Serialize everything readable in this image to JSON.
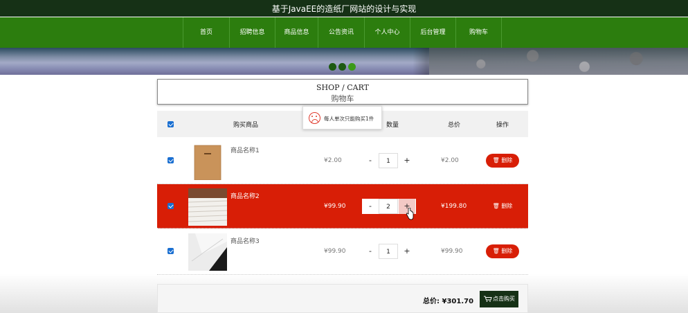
{
  "site": {
    "title": "基于JavaEE的造纸厂网站的设计与实现"
  },
  "nav": {
    "items": [
      {
        "label": "首页",
        "id": "home"
      },
      {
        "label": "招聘信息",
        "id": "jobs"
      },
      {
        "label": "商品信息",
        "id": "products"
      },
      {
        "label": "公告资讯",
        "id": "news"
      },
      {
        "label": "个人中心",
        "id": "profile"
      },
      {
        "label": "后台管理",
        "id": "admin"
      },
      {
        "label": "购物车",
        "id": "cart"
      }
    ]
  },
  "carousel": {
    "dots": 3,
    "active_index": 2
  },
  "page_header": {
    "title_en": "SHOP / CART",
    "title_zh": "购物车"
  },
  "tooltip": {
    "message": "每人单次只能购买1件",
    "icon": "sad-face-icon"
  },
  "table": {
    "headers": {
      "product": "购买商品",
      "qty": "数量",
      "total": "总价",
      "action": "操作"
    },
    "rows": [
      {
        "name": "商品名称1",
        "price": "¥2.00",
        "qty": "1",
        "total": "¥2.00",
        "checked": true,
        "delete_label": "删除",
        "minus": "-",
        "plus": "+"
      },
      {
        "name": "商品名称2",
        "price": "¥99.90",
        "qty": "2",
        "total": "¥199.80",
        "checked": true,
        "delete_label": "删除",
        "minus": "-",
        "plus": "+"
      },
      {
        "name": "商品名称3",
        "price": "¥99.90",
        "qty": "1",
        "total": "¥99.90",
        "checked": true,
        "delete_label": "删除",
        "minus": "-",
        "plus": "+"
      }
    ]
  },
  "footer": {
    "total_label": "总价:",
    "total_value": "¥301.70",
    "buy_label": "点击购买"
  },
  "colors": {
    "topbar": "#163116",
    "nav": "#2c7d0e",
    "accent_red": "#d81e06",
    "checkbox": "#1a6fd1"
  }
}
